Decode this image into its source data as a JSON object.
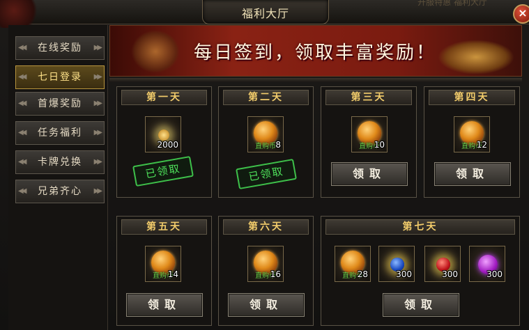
{
  "window": {
    "title": "福利大厅",
    "top_right_text": "开服特惠   福利大厅",
    "close_label": "×"
  },
  "sidebar": {
    "items": [
      {
        "label": "在线奖励",
        "active": false
      },
      {
        "label": "七日登录",
        "active": true
      },
      {
        "label": "首爆奖励",
        "active": false
      },
      {
        "label": "任务福利",
        "active": false
      },
      {
        "label": "卡牌兑换",
        "active": false
      },
      {
        "label": "兄弟齐心",
        "active": false
      }
    ]
  },
  "banner": {
    "text": "每日签到，领取丰富奖励！"
  },
  "days": [
    {
      "title": "第一天",
      "rewards": [
        {
          "icon": "gold-coin-icon",
          "label": "",
          "count": "2000"
        }
      ],
      "status": "已领取"
    },
    {
      "title": "第二天",
      "rewards": [
        {
          "icon": "ingot-coin-icon",
          "label": "直购币",
          "count": "8"
        }
      ],
      "status": "已领取"
    },
    {
      "title": "第三天",
      "rewards": [
        {
          "icon": "ingot-coin-icon",
          "label": "直购币",
          "count": "10"
        }
      ],
      "status": "领取"
    },
    {
      "title": "第四天",
      "rewards": [
        {
          "icon": "ingot-coin-icon",
          "label": "直购币",
          "count": "12"
        }
      ],
      "status": "领取"
    },
    {
      "title": "第五天",
      "rewards": [
        {
          "icon": "ingot-coin-icon",
          "label": "直购币",
          "count": "14"
        }
      ],
      "status": "领取"
    },
    {
      "title": "第六天",
      "rewards": [
        {
          "icon": "ingot-coin-icon",
          "label": "直购币",
          "count": "16"
        }
      ],
      "status": "领取"
    },
    {
      "title": "第七天",
      "rewards": [
        {
          "icon": "ingot-coin-icon",
          "label": "直购币",
          "count": "28"
        },
        {
          "icon": "blue-gem-icon",
          "label": "",
          "count": "300"
        },
        {
          "icon": "red-gem-icon",
          "label": "",
          "count": "300"
        },
        {
          "icon": "purple-gem-icon",
          "label": "",
          "count": "300"
        }
      ],
      "status": "领取"
    }
  ]
}
